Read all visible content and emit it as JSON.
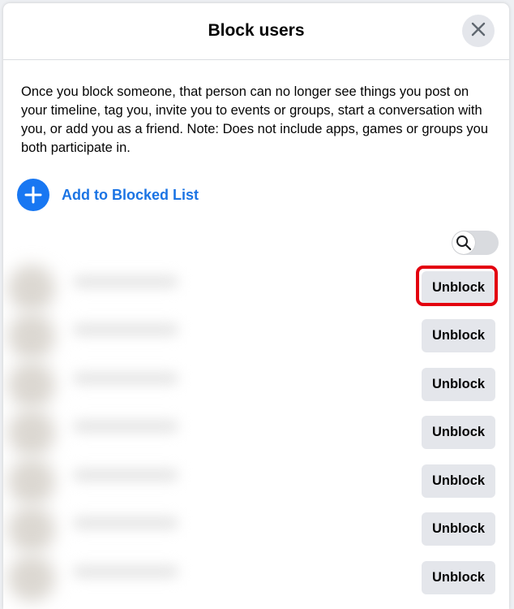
{
  "dialog": {
    "title": "Block users",
    "description": "Once you block someone, that person can no longer see things you post on your timeline, tag you, invite you to events or groups, start a conversation with you, or add you as a friend. Note: Does not include apps, games or groups you both participate in.",
    "add_label": "Add to Blocked List"
  },
  "blocked_list": {
    "unblock_label": "Unblock",
    "rows": [
      {
        "highlighted": true
      },
      {
        "highlighted": false
      },
      {
        "highlighted": false
      },
      {
        "highlighted": false
      },
      {
        "highlighted": false
      },
      {
        "highlighted": false
      },
      {
        "highlighted": false
      }
    ]
  },
  "colors": {
    "accent": "#1877f2",
    "link": "#1b74e4",
    "button_bg": "#e4e6eb",
    "highlight": "#e3000f"
  },
  "icons": {
    "close": "close-icon",
    "add": "plus-icon",
    "search": "search-icon"
  }
}
